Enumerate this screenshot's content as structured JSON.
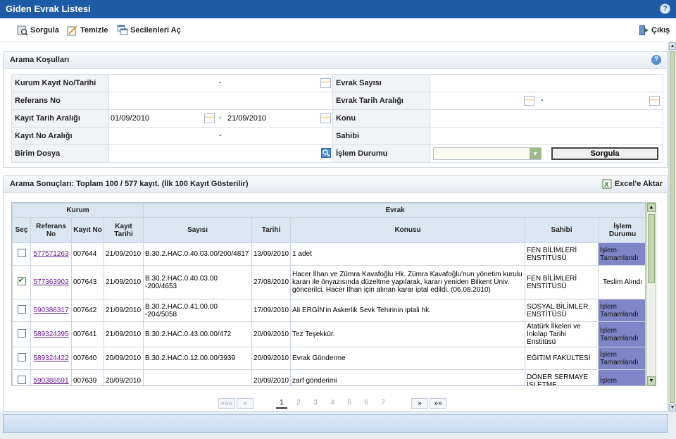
{
  "window": {
    "title": "Giden Evrak Listesi"
  },
  "toolbar": {
    "query": "Sorgula",
    "clear": "Temizle",
    "open_selected": "Secilenleri Aç",
    "exit": "Çıkış"
  },
  "search": {
    "title": "Arama Koşulları",
    "labels": {
      "kurum_kayit": "Kurum Kayıt No/Tarihi",
      "referans": "Referans No",
      "kayit_tarih": "Kayıt Tarih Aralığı",
      "kayit_no": "Kayıt No Aralığı",
      "birim": "Birim Dosya",
      "evrak_sayisi": "Evrak Sayısı",
      "evrak_tarih": "Evrak Tarih Aralığı",
      "konu": "Konu",
      "sahibi": "Sahibi",
      "islem_durumu": "İşlem Durumu"
    },
    "dash": "-",
    "date_from": "01/09/2010",
    "date_to": "21/09/2010",
    "button": "Sorgula"
  },
  "results": {
    "title": "Arama Sonuçları: Toplam 100 / 577 kayıt. (İlk 100 Kayıt Gösterilir)",
    "excel": "Excel'e Aktar",
    "group_kurum": "Kurum",
    "group_evrak": "Evrak",
    "columns": {
      "sec": "Seç",
      "ref": "Referans No",
      "kayit_no": "Kayıt No",
      "kayit_tarihi": "Kayıt Tarihi",
      "sayisi": "Sayısı",
      "tarihi": "Tarihi",
      "konusu": "Konusu",
      "sahibi": "Sahibi",
      "durum": "İşlem Durumu"
    },
    "rows": [
      {
        "checked": false,
        "ref": "577571263",
        "kayit_no": "007644",
        "kayit_tarihi": "21/09/2010",
        "sayisi": "B.30.2.HAC.0.40.03.00/200/4817",
        "tarihi": "13/09/2010",
        "konusu": "1 adet",
        "sahibi": "FEN BİLİMLERİ ENSTİTÜSÜ",
        "durum": "İşlem Tamamlandı",
        "durum_done": true
      },
      {
        "checked": true,
        "ref": "577363902",
        "kayit_no": "007643",
        "kayit_tarihi": "21/09/2010",
        "sayisi": "B.30.2.HAC.0.40.03.00 -200/4653",
        "tarihi": "27/08/2010",
        "konusu": "Hacer İlhan ve Zümra Kavafoğlu Hk. Zümra Kavafoğlu'nun yönetim kurulu kararı ile önyazısında düzeltme yapılarak, kararı yeniden Bilkent Üniv. göncerilci. Hacer İlhan için alınan karar iptal edildi. (06.08.2010)",
        "sahibi": "FEN BİLİMLERİ ENSTİTÜSÜ",
        "durum": "Teslim Alındı",
        "durum_done": false
      },
      {
        "checked": false,
        "ref": "590386317",
        "kayit_no": "007642",
        "kayit_tarihi": "21/09/2010",
        "sayisi": "B.30.2.HAC.0.41.00.00 -204/5058",
        "tarihi": "17/09/2010",
        "konusu": "Ali ERGİN'in Askerlik Sevk Tehirinin iptali hk.",
        "sahibi": "SOSYAL BİLİMLER ENSTİTÜSÜ",
        "durum": "İşlem Tamamlandı",
        "durum_done": true
      },
      {
        "checked": false,
        "ref": "589324395",
        "kayit_no": "007641",
        "kayit_tarihi": "21/09/2010",
        "sayisi": "B.30.2.HAC.0.43.00.00/472",
        "tarihi": "20/09/2010",
        "konusu": "Tez Teşekkür.",
        "sahibi": "Atatürk İlkeleri ve İnkılap Tarihi Enstitüsü",
        "durum": "İşlem Tamamlandı",
        "durum_done": true
      },
      {
        "checked": false,
        "ref": "589324422",
        "kayit_no": "007640",
        "kayit_tarihi": "20/09/2010",
        "sayisi": "B.30.2.HAC.0.12.00.00/3939",
        "tarihi": "20/09/2010",
        "konusu": "Evrak Gönderme",
        "sahibi": "EĞİTİM FAKÜLTESİ",
        "durum": "İşlem Tamamlandı",
        "durum_done": true
      },
      {
        "checked": false,
        "ref": "590386691",
        "kayit_no": "007639",
        "kayit_tarihi": "20/09/2010",
        "sayisi": "",
        "tarihi": "20/09/2010",
        "konusu": "zarf gönderimi",
        "sahibi": "DÖNER SERMAYE İŞLETME",
        "durum": "İşlem",
        "durum_done": true
      }
    ]
  },
  "pager": {
    "first": "«««",
    "prev": "«",
    "pages": [
      "1",
      "2",
      "3",
      "4",
      "5",
      "6",
      "7"
    ],
    "current": "1",
    "next": "»",
    "last": "»»"
  }
}
